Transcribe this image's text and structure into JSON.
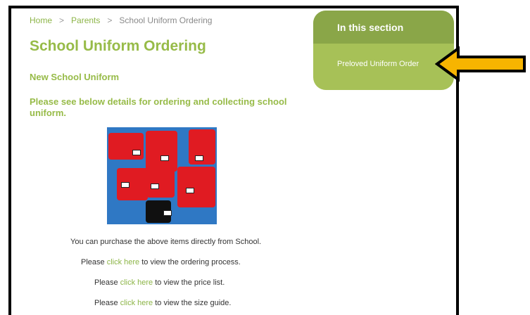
{
  "breadcrumb": {
    "home": "Home",
    "parents": "Parents",
    "current": "School Uniform Ordering",
    "separator": ">"
  },
  "page": {
    "title": "School Uniform Ordering",
    "subtitle": "New School Uniform",
    "intro": "Please see below details for ordering and collecting school uniform."
  },
  "content": {
    "purchase_text": "You can purchase the above items directly from School.",
    "lines": [
      {
        "prefix": "Please",
        "link": "click here",
        "suffix": "to view the ordering process."
      },
      {
        "prefix": "Please",
        "link": "click here",
        "suffix": "to view the price list."
      },
      {
        "prefix": "Please",
        "link": "click here",
        "suffix": "to view the size guide."
      }
    ]
  },
  "sidebar": {
    "heading": "In this section",
    "items": [
      {
        "label": "Preloved Uniform Order"
      }
    ]
  },
  "colors": {
    "accent": "#97bb48",
    "sidebar_head": "#8aa648",
    "sidebar_body": "#a7c157",
    "arrow": "#f7b400"
  },
  "icons": {
    "annotation": "arrow-left-icon"
  }
}
